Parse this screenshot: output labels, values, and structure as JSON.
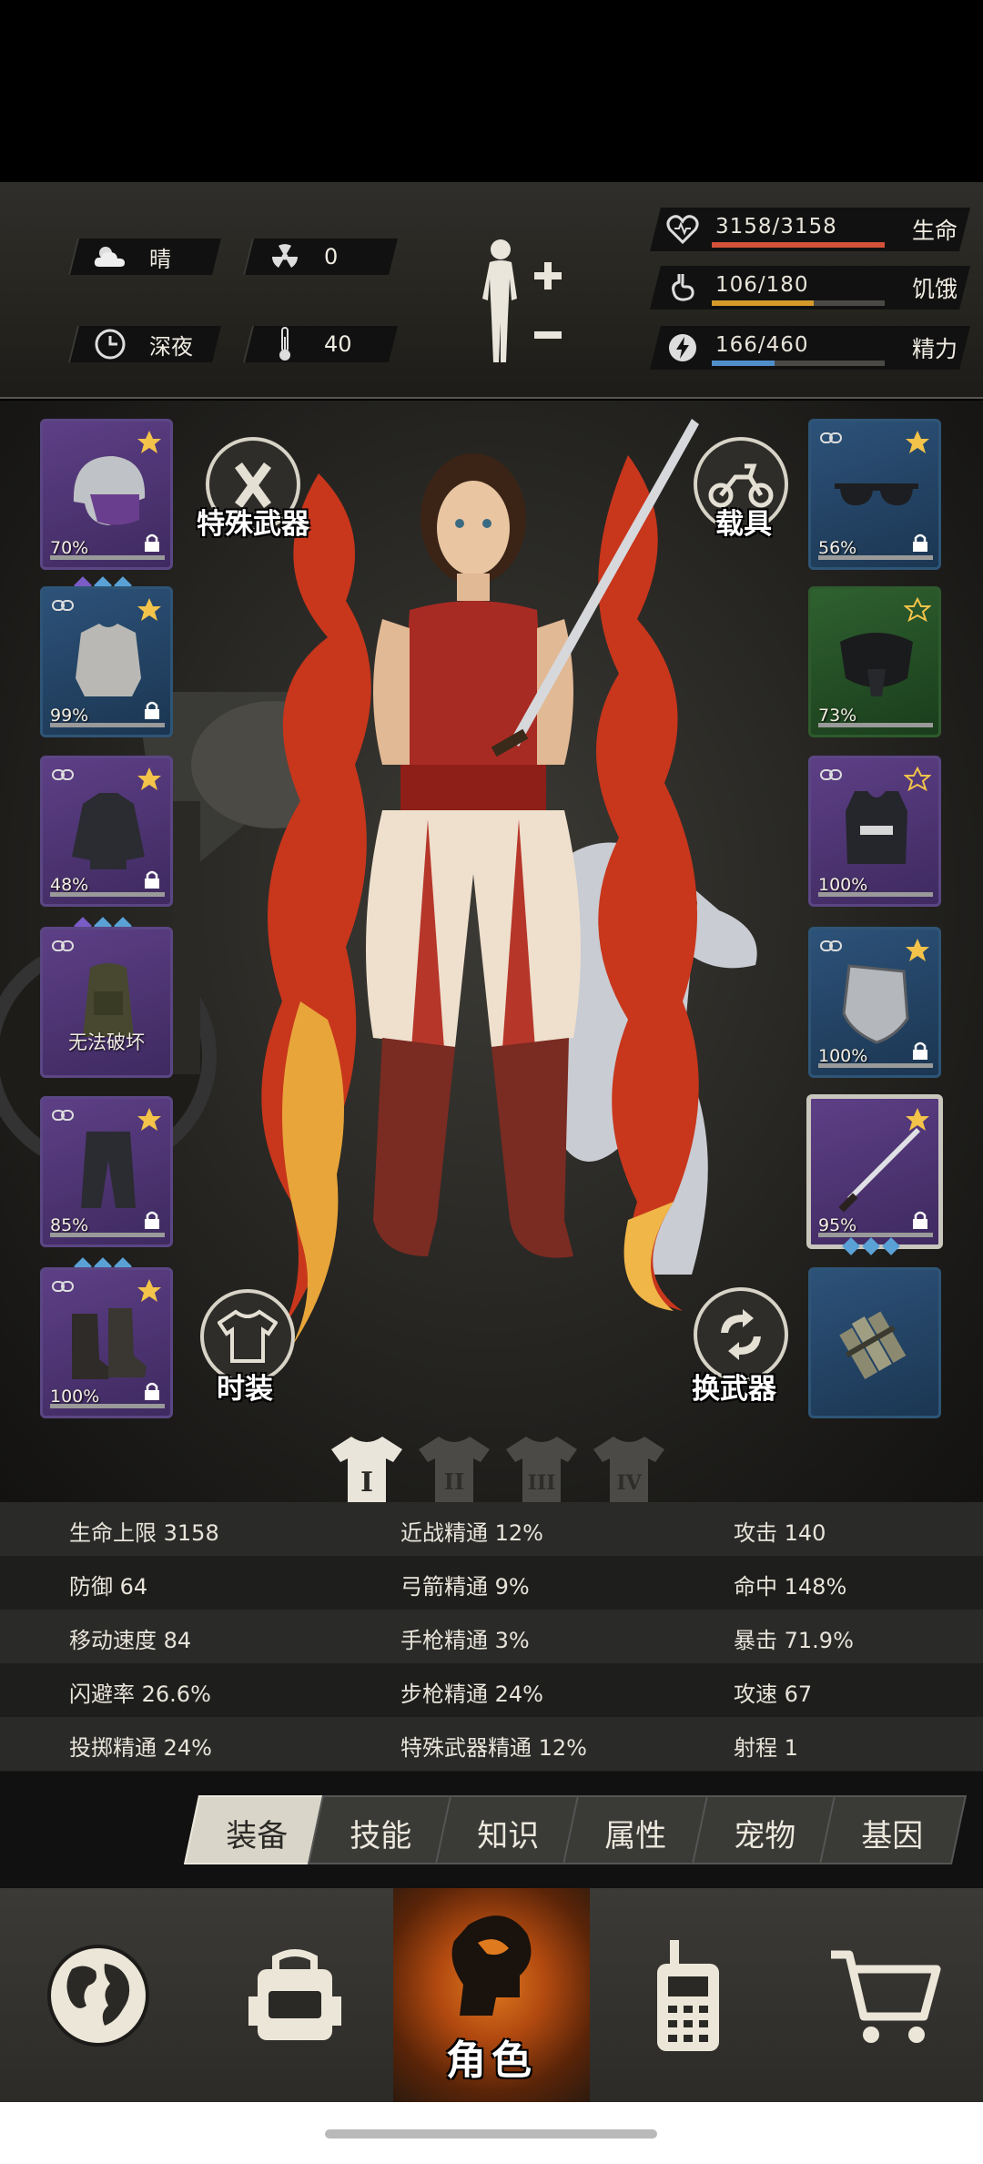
{
  "environment": {
    "weather": "晴",
    "radiation": "0",
    "time_of_day": "深夜",
    "temperature": "40"
  },
  "vitals": [
    {
      "label": "生命",
      "value": "3158/3158",
      "fraction": 1.0,
      "color": "#d4513a",
      "icon": "heart-icon"
    },
    {
      "label": "饥饿",
      "value": "106/180",
      "fraction": 0.589,
      "color": "#d49a2a",
      "icon": "stomach-icon"
    },
    {
      "label": "精力",
      "value": "166/460",
      "fraction": 0.361,
      "color": "#4f8ec9",
      "icon": "lightning-icon"
    }
  ],
  "body_status_icon": "body-health-icon",
  "left_slots": [
    {
      "name": "helmet",
      "percent": "70%",
      "color": "purple",
      "star": "filled",
      "locked": true,
      "gems": [
        "#7a5cc7",
        "#5aa2d6",
        "#5aa2d6"
      ]
    },
    {
      "name": "shirt",
      "percent": "99%",
      "color": "blue",
      "star": "filled",
      "locked": true
    },
    {
      "name": "jacket",
      "percent": "48%",
      "color": "purple",
      "star": "filled",
      "locked": true,
      "gems": [
        "#7a5cc7",
        "#5aa2d6",
        "#5aa2d6"
      ]
    },
    {
      "name": "backpack",
      "note": "无法破坏",
      "color": "purple"
    },
    {
      "name": "pants",
      "percent": "85%",
      "color": "purple",
      "star": "filled",
      "locked": true,
      "gems": [
        "#5aa2d6",
        "#5aa2d6",
        "#5aa2d6"
      ]
    },
    {
      "name": "boots",
      "percent": "100%",
      "color": "purple",
      "star": "filled",
      "locked": true
    }
  ],
  "right_slots": [
    {
      "name": "sunglasses",
      "percent": "56%",
      "color": "blue",
      "star": "filled",
      "locked": true
    },
    {
      "name": "gas-mask",
      "percent": "73%",
      "color": "green",
      "star": "outline"
    },
    {
      "name": "police-vest",
      "percent": "100%",
      "color": "purple",
      "star": "outline"
    },
    {
      "name": "shield",
      "percent": "100%",
      "color": "blue",
      "star": "filled",
      "locked": true
    },
    {
      "name": "katana",
      "percent": "95%",
      "color": "purple",
      "star": "filled",
      "locked": true,
      "selected": true,
      "gems": [
        "#5aa2d6",
        "#5aa2d6",
        "#5aa2d6"
      ]
    },
    {
      "name": "explosive-bundle",
      "color": "blue"
    }
  ],
  "actions": {
    "special_weapon": "特殊武器",
    "vehicle": "载具",
    "fashion": "时装",
    "switch_weapon": "换武器"
  },
  "outfit_tabs": [
    "I",
    "II",
    "III",
    "IV"
  ],
  "stats": [
    [
      {
        "label": "生命上限",
        "value": "3158"
      },
      {
        "label": "近战精通",
        "value": "12%"
      },
      {
        "label": "攻击",
        "value": "140"
      }
    ],
    [
      {
        "label": "防御",
        "value": "64"
      },
      {
        "label": "弓箭精通",
        "value": "9%"
      },
      {
        "label": "命中",
        "value": "148%"
      }
    ],
    [
      {
        "label": "移动速度",
        "value": "84"
      },
      {
        "label": "手枪精通",
        "value": "3%"
      },
      {
        "label": "暴击",
        "value": "71.9%"
      }
    ],
    [
      {
        "label": "闪避率",
        "value": "26.6%"
      },
      {
        "label": "步枪精通",
        "value": "24%"
      },
      {
        "label": "攻速",
        "value": "67"
      }
    ],
    [
      {
        "label": "投掷精通",
        "value": "24%"
      },
      {
        "label": "特殊武器精通",
        "value": "12%"
      },
      {
        "label": "射程",
        "value": "1"
      }
    ]
  ],
  "tabs": [
    "装备",
    "技能",
    "知识",
    "属性",
    "宠物",
    "基因"
  ],
  "active_tab": 0,
  "nav": [
    {
      "icon": "globe-icon"
    },
    {
      "icon": "backpack-icon"
    },
    {
      "icon": "character-icon",
      "label": "角色",
      "active": true
    },
    {
      "icon": "radio-icon"
    },
    {
      "icon": "cart-icon"
    }
  ]
}
